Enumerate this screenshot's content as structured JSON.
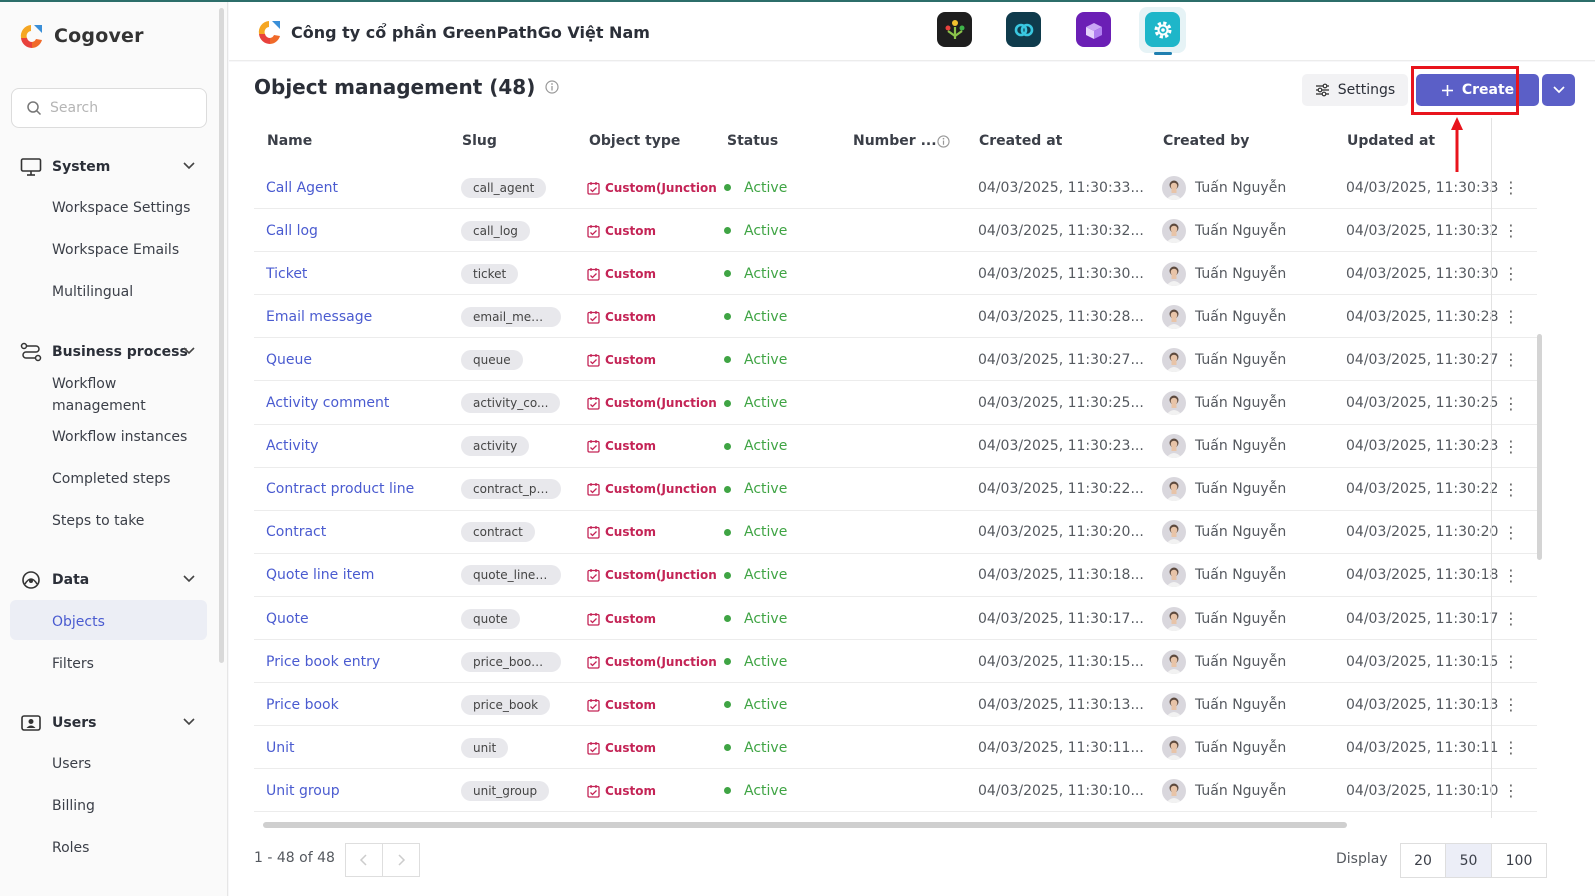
{
  "app": {
    "brand_name": "Cogover",
    "company_name": "Công ty cổ phần GreenPathGo Việt Nam"
  },
  "sidebar": {
    "search_placeholder": "Search",
    "sections": [
      {
        "label": "System",
        "icon": "monitor-icon",
        "items": [
          "Workspace Settings",
          "Workspace Emails",
          "Multilingual"
        ]
      },
      {
        "label": "Business process",
        "icon": "flow-icon",
        "items": [
          "Workflow management",
          "Workflow instances",
          "Completed steps",
          "Steps to take"
        ]
      },
      {
        "label": "Data",
        "icon": "data-icon",
        "items": [
          "Objects",
          "Filters"
        ]
      },
      {
        "label": "Users",
        "icon": "users-icon",
        "items": [
          "Users",
          "Billing",
          "Roles"
        ]
      }
    ],
    "active_item": "Objects"
  },
  "header": {
    "apps": [
      {
        "icon": "people-tree-app-icon",
        "color": "#1e1e1e"
      },
      {
        "icon": "link-app-icon",
        "color": "#0f3b4c"
      },
      {
        "icon": "heart-box-app-icon",
        "color": "#6b1fb5"
      },
      {
        "icon": "gear-app-icon",
        "color": "#1eb6c9"
      }
    ]
  },
  "page": {
    "title": "Object management (48)",
    "settings_label": "Settings",
    "create_label": "Create"
  },
  "table": {
    "columns": [
      "Name",
      "Slug",
      "Object type",
      "Status",
      "Number ...",
      "Created at",
      "Created by",
      "Updated at"
    ],
    "rows": [
      {
        "name": "Call Agent",
        "slug": "call_agent",
        "type": "Custom(Junction",
        "status": "Active",
        "created_at": "04/03/2025, 11:30:33...",
        "created_by": "Tuấn Nguyễn",
        "updated_at": "04/03/2025, 11:30:33"
      },
      {
        "name": "Call log",
        "slug": "call_log",
        "type": "Custom",
        "status": "Active",
        "created_at": "04/03/2025, 11:30:32...",
        "created_by": "Tuấn Nguyễn",
        "updated_at": "04/03/2025, 11:30:32"
      },
      {
        "name": "Ticket",
        "slug": "ticket",
        "type": "Custom",
        "status": "Active",
        "created_at": "04/03/2025, 11:30:30...",
        "created_by": "Tuấn Nguyễn",
        "updated_at": "04/03/2025, 11:30:30"
      },
      {
        "name": "Email message",
        "slug": "email_mess...",
        "type": "Custom",
        "status": "Active",
        "created_at": "04/03/2025, 11:30:28...",
        "created_by": "Tuấn Nguyễn",
        "updated_at": "04/03/2025, 11:30:28"
      },
      {
        "name": "Queue",
        "slug": "queue",
        "type": "Custom",
        "status": "Active",
        "created_at": "04/03/2025, 11:30:27...",
        "created_by": "Tuấn Nguyễn",
        "updated_at": "04/03/2025, 11:30:27"
      },
      {
        "name": "Activity comment",
        "slug": "activity_co...",
        "type": "Custom(Junction",
        "status": "Active",
        "created_at": "04/03/2025, 11:30:25...",
        "created_by": "Tuấn Nguyễn",
        "updated_at": "04/03/2025, 11:30:25"
      },
      {
        "name": "Activity",
        "slug": "activity",
        "type": "Custom",
        "status": "Active",
        "created_at": "04/03/2025, 11:30:23...",
        "created_by": "Tuấn Nguyễn",
        "updated_at": "04/03/2025, 11:30:23"
      },
      {
        "name": "Contract product line",
        "slug": "contract_pr...",
        "type": "Custom(Junction",
        "status": "Active",
        "created_at": "04/03/2025, 11:30:22...",
        "created_by": "Tuấn Nguyễn",
        "updated_at": "04/03/2025, 11:30:22"
      },
      {
        "name": "Contract",
        "slug": "contract",
        "type": "Custom",
        "status": "Active",
        "created_at": "04/03/2025, 11:30:20...",
        "created_by": "Tuấn Nguyễn",
        "updated_at": "04/03/2025, 11:30:20"
      },
      {
        "name": "Quote line item",
        "slug": "quote_line_...",
        "type": "Custom(Junction",
        "status": "Active",
        "created_at": "04/03/2025, 11:30:18...",
        "created_by": "Tuấn Nguyễn",
        "updated_at": "04/03/2025, 11:30:18"
      },
      {
        "name": "Quote",
        "slug": "quote",
        "type": "Custom",
        "status": "Active",
        "created_at": "04/03/2025, 11:30:17...",
        "created_by": "Tuấn Nguyễn",
        "updated_at": "04/03/2025, 11:30:17"
      },
      {
        "name": "Price book entry",
        "slug": "price_book...",
        "type": "Custom(Junction",
        "status": "Active",
        "created_at": "04/03/2025, 11:30:15...",
        "created_by": "Tuấn Nguyễn",
        "updated_at": "04/03/2025, 11:30:15"
      },
      {
        "name": "Price book",
        "slug": "price_book",
        "type": "Custom",
        "status": "Active",
        "created_at": "04/03/2025, 11:30:13...",
        "created_by": "Tuấn Nguyễn",
        "updated_at": "04/03/2025, 11:30:13"
      },
      {
        "name": "Unit",
        "slug": "unit",
        "type": "Custom",
        "status": "Active",
        "created_at": "04/03/2025, 11:30:11...",
        "created_by": "Tuấn Nguyễn",
        "updated_at": "04/03/2025, 11:30:11"
      },
      {
        "name": "Unit group",
        "slug": "unit_group",
        "type": "Custom",
        "status": "Active",
        "created_at": "04/03/2025, 11:30:10...",
        "created_by": "Tuấn Nguyễn",
        "updated_at": "04/03/2025, 11:30:10"
      }
    ]
  },
  "pagination": {
    "range_text": "1 - 48 of 48",
    "display_label": "Display",
    "sizes": [
      "20",
      "50",
      "100"
    ],
    "selected_size": "50"
  },
  "colors": {
    "accent": "#5b5fc7",
    "link": "#4a5bd0",
    "active_status": "#3fa444",
    "custom_type": "#c42456",
    "highlight": "#e8141c"
  }
}
